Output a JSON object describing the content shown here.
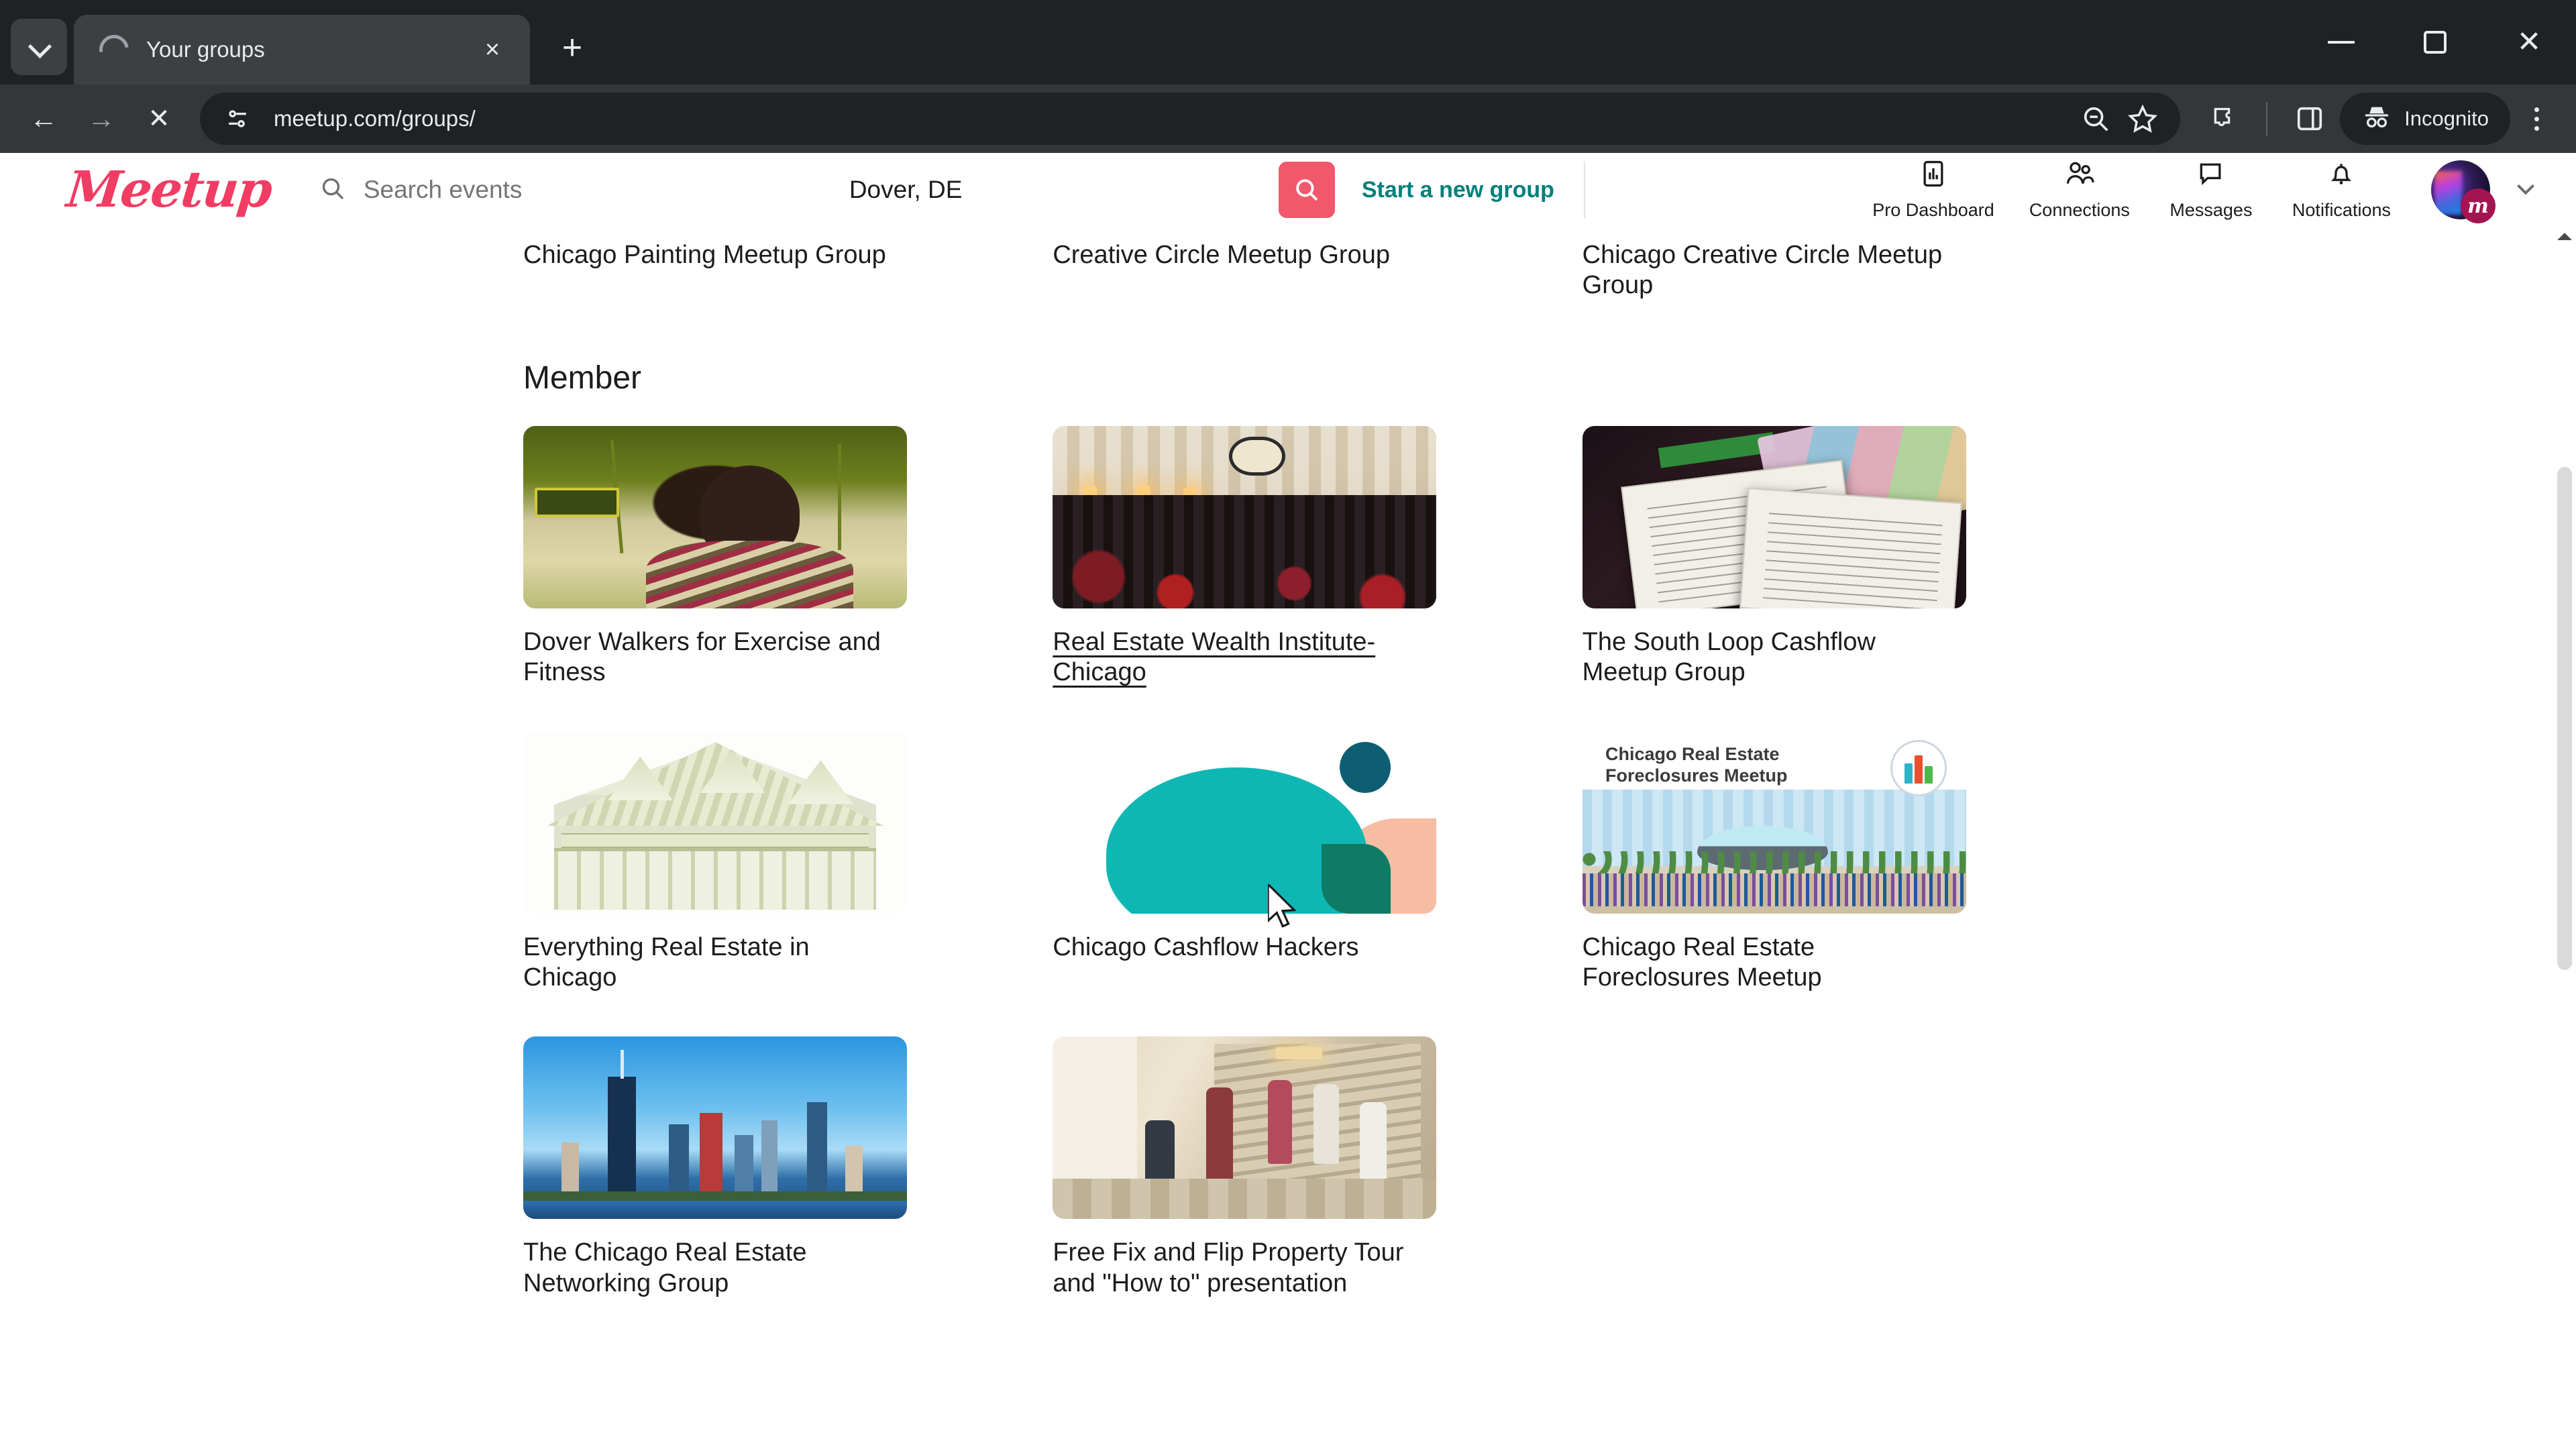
{
  "browser": {
    "tab": {
      "title": "Your groups",
      "loading": true
    },
    "tab_search_icon": "chevron-down-icon",
    "new_tab_label": "+",
    "close_tab_label": "×",
    "window": {
      "minimize": "–",
      "maximize": "□",
      "close": "×"
    },
    "toolbar": {
      "back": "←",
      "forward": "→",
      "stop": "✕",
      "url": "meetup.com/groups/",
      "site_settings_icon": "tune-icon",
      "zoom_icon": "zoom-out-icon",
      "bookmark_icon": "star-icon",
      "extensions_icon": "puzzle-icon",
      "side_panel_icon": "side-panel-icon",
      "incognito_label": "Incognito",
      "incognito_icon": "incognito-hat-icon",
      "menu_icon": "kebab-menu-icon"
    }
  },
  "site": {
    "logo_text": "Meetup",
    "search": {
      "placeholder": "Search events",
      "icon": "search-icon"
    },
    "location": {
      "value": "Dover, DE"
    },
    "search_button_icon": "search-icon",
    "start_group_label": "Start a new group",
    "nav": [
      {
        "label": "Pro Dashboard",
        "icon": "chart-bar-icon"
      },
      {
        "label": "Connections",
        "icon": "people-icon"
      },
      {
        "label": "Messages",
        "icon": "chat-bubble-icon"
      },
      {
        "label": "Notifications",
        "icon": "bell-icon"
      }
    ],
    "avatar": {
      "badge": "m",
      "chevron": "chevron-down-icon"
    }
  },
  "main": {
    "cutoff_row": [
      {
        "title": "Chicago Painting Meetup Group"
      },
      {
        "title": "Creative Circle Meetup Group"
      },
      {
        "title": "Chicago Creative Circle Meetup Group"
      }
    ],
    "section_heading": "Member",
    "groups": [
      {
        "title": "Dover Walkers for Exercise and Fitness",
        "image": "woman-palm-trees",
        "hovered": false
      },
      {
        "title": "Real Estate Wealth Institute-Chicago",
        "image": "conference-hall-crowd",
        "hovered": true
      },
      {
        "title": "The South Loop Cashflow Meetup Group",
        "image": "documents-checks",
        "hovered": false
      },
      {
        "title": "Everything Real Estate in Chicago",
        "image": "money-house",
        "hovered": false
      },
      {
        "title": "Chicago Cashflow Hackers",
        "image": "abstract-teal-shapes",
        "hovered": false
      },
      {
        "title": "Chicago Real Estate Foreclosures Meetup",
        "image": "foreclosures-banner",
        "banner_text": "Chicago Real Estate Foreclosures Meetup",
        "hovered": false
      },
      {
        "title": "The Chicago Real Estate Networking Group",
        "image": "chicago-skyline",
        "hovered": false
      },
      {
        "title": "Free Fix and Flip Property Tour and \"How to\" presentation",
        "image": "property-tour-people",
        "hovered": false
      }
    ]
  },
  "colors": {
    "brand_pink": "#f13c63",
    "search_button": "#f2586c",
    "start_group_teal": "#00807d",
    "chrome_dark": "#202124",
    "toolbar_dark": "#35363a",
    "abstract_teal": "#0fb7b4",
    "abstract_navy": "#0d5e73",
    "abstract_peach": "#f6bda3"
  }
}
